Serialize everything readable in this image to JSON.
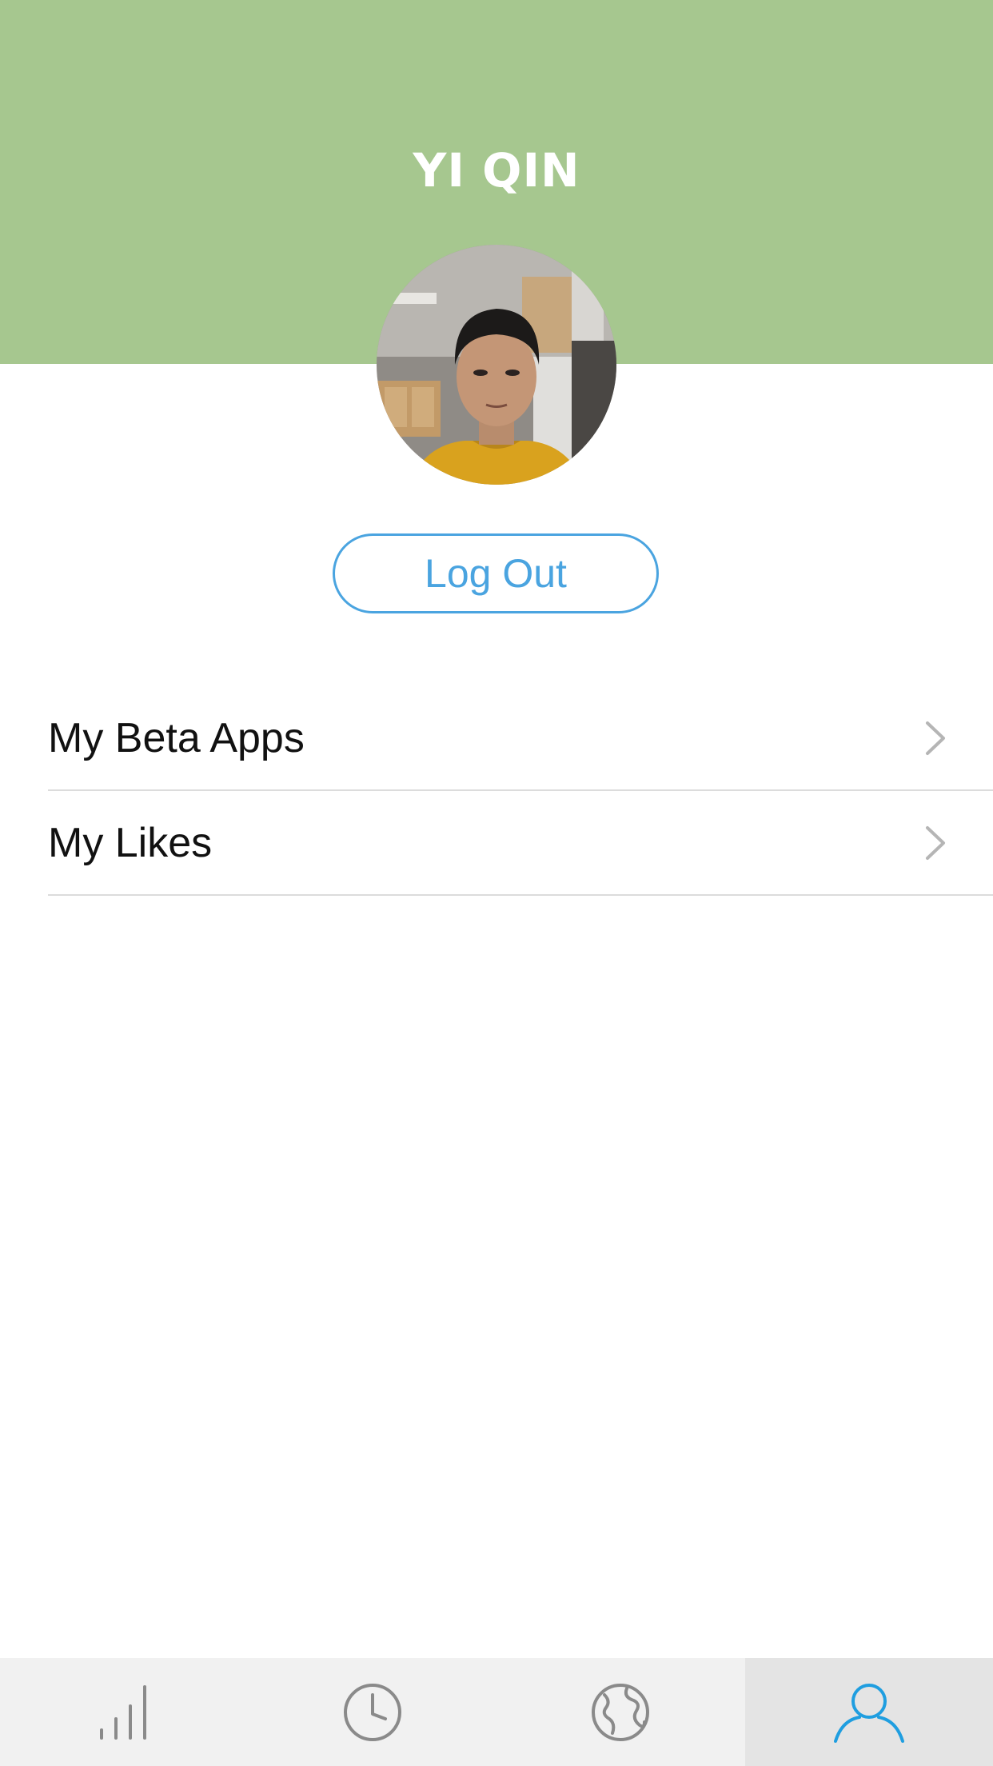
{
  "header": {
    "title": "YI QIN",
    "background_color": "#a6c78f"
  },
  "profile": {
    "avatar_icon": "avatar-photo"
  },
  "actions": {
    "logout_label": "Log Out",
    "accent_color": "#4aa4e0"
  },
  "menu": {
    "items": [
      {
        "label": "My Beta Apps",
        "icon": "chevron-right-icon"
      },
      {
        "label": "My Likes",
        "icon": "chevron-right-icon"
      }
    ]
  },
  "tabbar": {
    "tabs": [
      {
        "icon": "bar-chart-icon",
        "active": false
      },
      {
        "icon": "clock-icon",
        "active": false
      },
      {
        "icon": "globe-icon",
        "active": false
      },
      {
        "icon": "user-icon",
        "active": true
      }
    ],
    "active_color": "#1f9ee0",
    "inactive_color": "#8a8a8a"
  }
}
